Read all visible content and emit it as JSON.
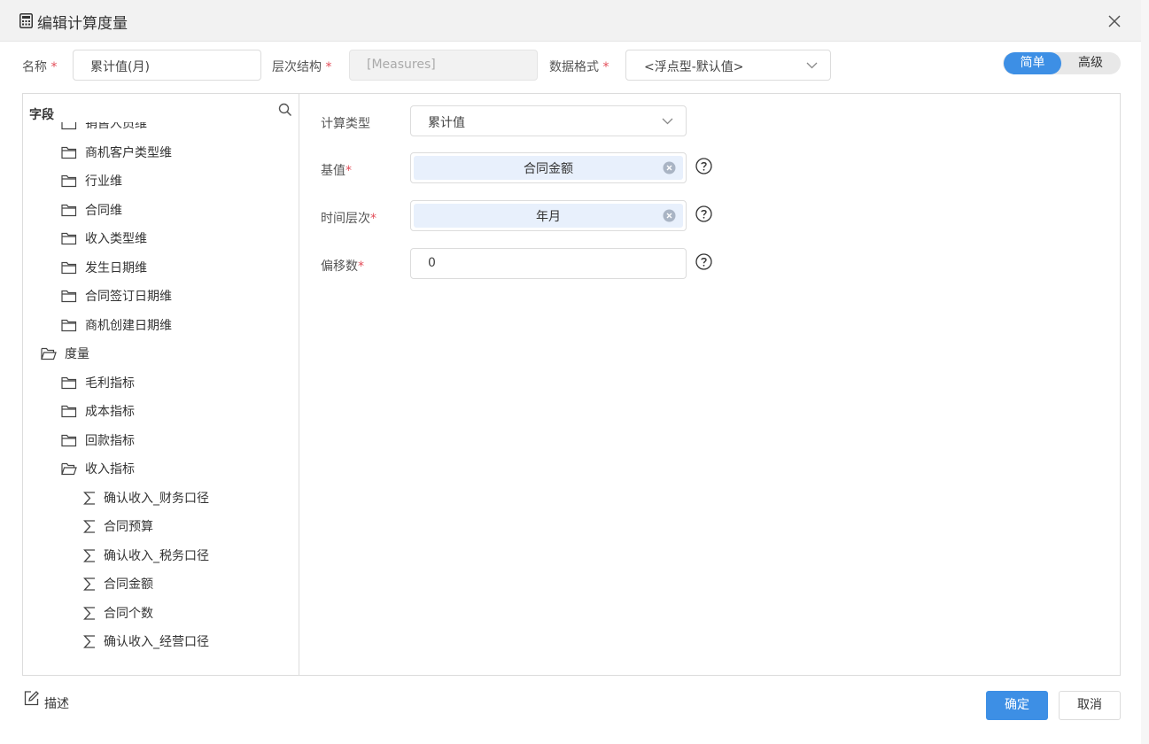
{
  "dialog": {
    "title": "编辑计算度量"
  },
  "header_form": {
    "name_label": "名称",
    "name_value": "累计值(月)",
    "hierarchy_label": "层次结构",
    "hierarchy_value": "[Measures]",
    "format_label": "数据格式",
    "format_value": "<浮点型-默认值>",
    "required_mark": "*"
  },
  "mode_toggle": {
    "simple": "简单",
    "advanced": "高级",
    "selected": "简单"
  },
  "field_panel": {
    "heading": "字段",
    "items": [
      {
        "label": "销售人员维",
        "kind": "folder",
        "level": 1
      },
      {
        "label": "商机客户类型维",
        "kind": "folder",
        "level": 1
      },
      {
        "label": "行业维",
        "kind": "folder",
        "level": 1
      },
      {
        "label": "合同维",
        "kind": "folder",
        "level": 1
      },
      {
        "label": "收入类型维",
        "kind": "folder",
        "level": 1
      },
      {
        "label": "发生日期维",
        "kind": "folder",
        "level": 1
      },
      {
        "label": "合同签订日期维",
        "kind": "folder",
        "level": 1
      },
      {
        "label": "商机创建日期维",
        "kind": "folder",
        "level": 1
      },
      {
        "label": "度量",
        "kind": "folder-open",
        "level": 0
      },
      {
        "label": "毛利指标",
        "kind": "folder",
        "level": 1
      },
      {
        "label": "成本指标",
        "kind": "folder",
        "level": 1
      },
      {
        "label": "回款指标",
        "kind": "folder",
        "level": 1
      },
      {
        "label": "收入指标",
        "kind": "folder-open",
        "level": 1
      },
      {
        "label": "确认收入_财务口径",
        "kind": "measure",
        "level": 2
      },
      {
        "label": "合同预算",
        "kind": "measure",
        "level": 2
      },
      {
        "label": "确认收入_税务口径",
        "kind": "measure",
        "level": 2
      },
      {
        "label": "合同金额",
        "kind": "measure",
        "level": 2
      },
      {
        "label": "合同个数",
        "kind": "measure",
        "level": 2
      },
      {
        "label": "确认收入_经营口径",
        "kind": "measure",
        "level": 2
      }
    ]
  },
  "calc_form": {
    "calc_type_label": "计算类型",
    "calc_type_value": "累计值",
    "base_label": "基值",
    "base_value": "合同金额",
    "time_level_label": "时间层次",
    "time_level_value": "年月",
    "offset_label": "偏移数",
    "offset_value": "0"
  },
  "footer": {
    "description_label": "描述",
    "ok_label": "确定",
    "cancel_label": "取消"
  },
  "colors": {
    "accent": "#3d8fe5",
    "required": "#e34d59",
    "tag_bg": "#e8f0fc"
  },
  "icons": [
    "calculator-icon",
    "close-icon",
    "search-icon",
    "folder-icon",
    "folder-open-icon",
    "sigma-icon",
    "help-icon",
    "edit-icon",
    "chevron-down-icon",
    "clear-icon"
  ]
}
